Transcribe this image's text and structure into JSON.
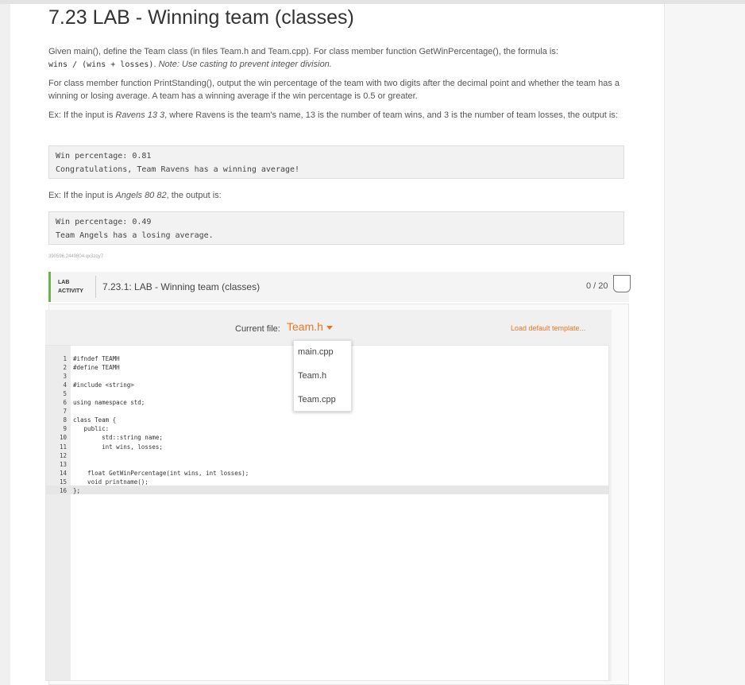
{
  "title": "7.23 LAB - Winning team (classes)",
  "para1": {
    "text": "Given main(), define the Team class (in files Team.h and Team.cpp). For class member function GetWinPercentage(), the formula is:",
    "formula": "wins / (wins + losses)",
    "note_prefix": ". ",
    "note": "Note: Use casting to prevent integer division."
  },
  "para2": "For class member function PrintStanding(), output the win percentage of the team with two digits after the decimal point and whether the team has a winning or losing average. A team has a winning average if the win percentage is 0.5 or greater.",
  "para3": {
    "prefix": "Ex: If the input is ",
    "input": "Ravens 13 3",
    "suffix": ", where Ravens is the team's name, 13 is the number of team wins, and 3 is the number of team losses, the output is:"
  },
  "output1": [
    "Win percentage: 0.81",
    "Congratulations, Team Ravens has a winning average!"
  ],
  "para4": {
    "prefix": "Ex: If the input is ",
    "input": "Angels 80 82",
    "suffix": ", the output is:"
  },
  "output2": [
    "Win percentage: 0.49",
    "Team Angels has a losing average."
  ],
  "hash_id": "390596.2449804.qx3zqy7",
  "lab": {
    "tag_line1": "LAB",
    "tag_line2": "ACTIVITY",
    "title": "7.23.1: LAB - Winning team (classes)",
    "score": "0 / 20"
  },
  "filebar": {
    "label": "Current file:",
    "current": "Team.h",
    "load_default": "Load default template..."
  },
  "files": [
    "main.cpp",
    "Team.h",
    "Team.cpp"
  ],
  "code_lines": [
    "#ifndef TEAMH",
    "#define TEAMH",
    "",
    "#include <string>",
    "",
    "using namespace std;",
    "",
    "class Team {",
    "   public:",
    "        std::string name;",
    "        int wins, losses;",
    "",
    "",
    "    float GetWinPercentage(int wins, int losses);",
    "    void printname();",
    "};"
  ],
  "colors": {
    "accent": "#e87722",
    "lab_green": "#69b64b"
  }
}
